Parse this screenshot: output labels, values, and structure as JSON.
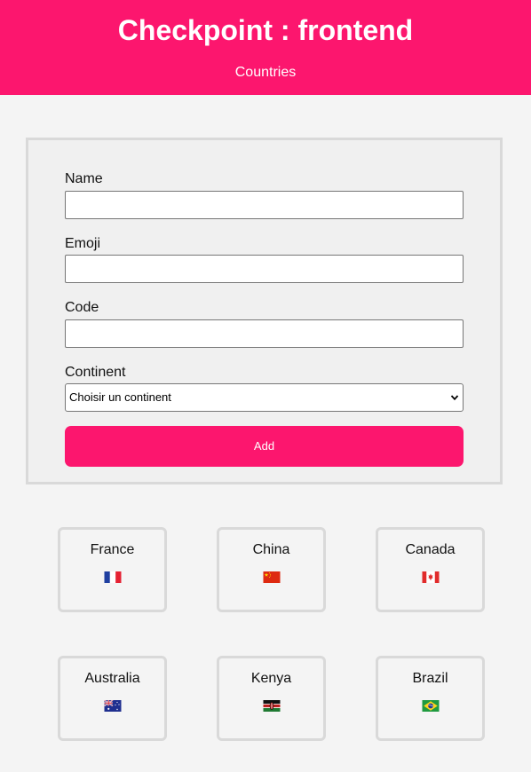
{
  "header": {
    "title": "Checkpoint : frontend",
    "nav_link": "Countries"
  },
  "form": {
    "name_label": "Name",
    "name_value": "",
    "emoji_label": "Emoji",
    "emoji_value": "",
    "code_label": "Code",
    "code_value": "",
    "continent_label": "Continent",
    "continent_selected": "Choisir un continent",
    "add_label": "Add"
  },
  "colors": {
    "brand": "#fc166e",
    "background": "#f4f4f4",
    "border": "#d9d9d9"
  },
  "countries": [
    {
      "name": "France",
      "flag": "france-flag-icon"
    },
    {
      "name": "China",
      "flag": "china-flag-icon"
    },
    {
      "name": "Canada",
      "flag": "canada-flag-icon"
    },
    {
      "name": "Australia",
      "flag": "australia-flag-icon"
    },
    {
      "name": "Kenya",
      "flag": "kenya-flag-icon"
    },
    {
      "name": "Brazil",
      "flag": "brazil-flag-icon"
    }
  ]
}
